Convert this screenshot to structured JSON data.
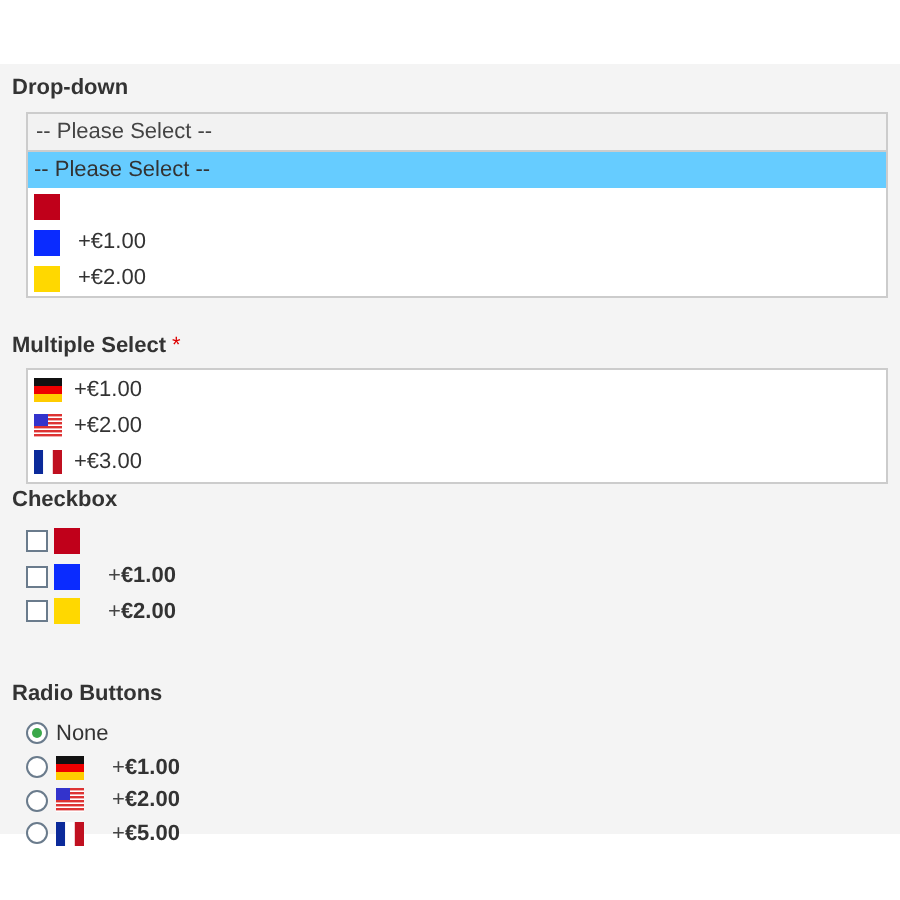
{
  "dropdown": {
    "title": "Drop-down",
    "value": "-- Please Select --",
    "options": [
      {
        "label": "-- Please Select --",
        "selected": true
      },
      {
        "color": "#c0001a",
        "selected": false
      },
      {
        "color": "#0a2bff",
        "price": "+€1.00",
        "selected": false
      },
      {
        "color": "#ffd800",
        "price": "+€2.00",
        "selected": false
      }
    ]
  },
  "multiple_select": {
    "title": "Multiple Select",
    "required_mark": "*",
    "options": [
      {
        "kind": "de",
        "price": "+€1.00",
        "selected": false
      },
      {
        "kind": "us",
        "price": "+€2.00",
        "selected": false
      },
      {
        "kind": "fr",
        "price": "+€3.00",
        "selected": false
      }
    ]
  },
  "checkbox": {
    "title": "Checkbox",
    "items": [
      {
        "color": "#c0001a",
        "checked": false
      },
      {
        "color": "#0a2bff",
        "price": "+**€1.00**",
        "checked": false
      },
      {
        "color": "#ffd800",
        "price": "+**€2.00**",
        "checked": false
      }
    ]
  },
  "radio_buttons": {
    "title": "Radio Buttons",
    "items": [
      {
        "kind": "none",
        "label": "None",
        "selected": true
      },
      {
        "kind": "de",
        "price": "+**€1.00**",
        "selected": false
      },
      {
        "kind": "us",
        "price": "+**€2.00**",
        "selected": false
      },
      {
        "kind": "fr",
        "price": "+**€5.00**",
        "selected": false
      }
    ]
  }
}
